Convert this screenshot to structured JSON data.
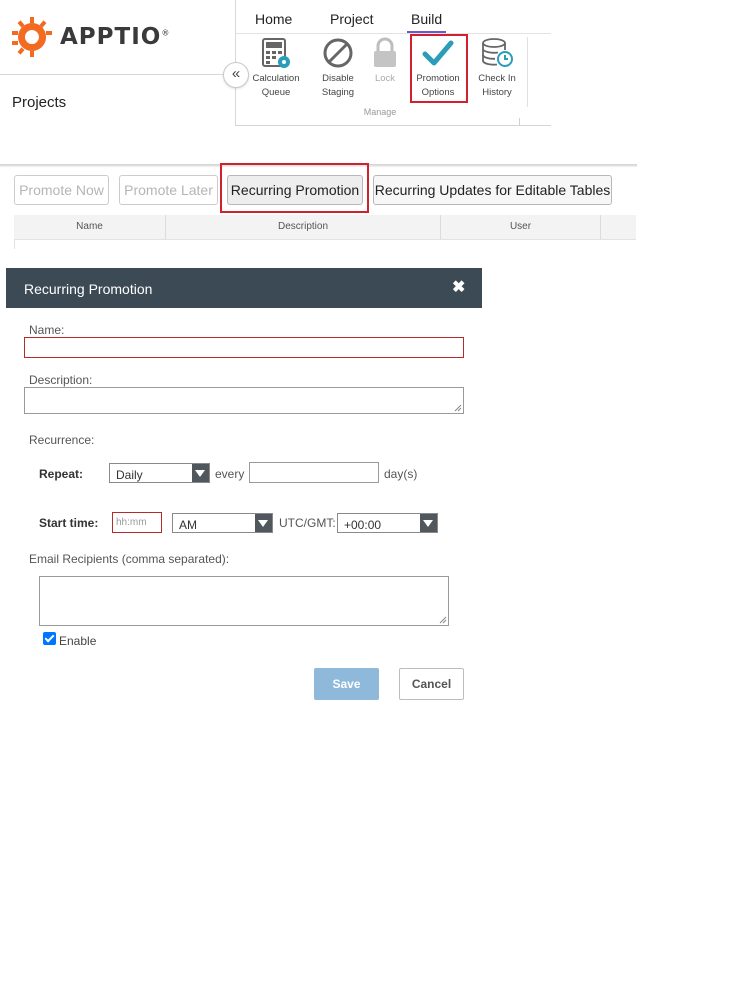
{
  "app": {
    "logo_text": "APPTIO",
    "logo_mark": "®"
  },
  "sidebar": {
    "title": "Projects"
  },
  "tabs": [
    {
      "label": "Home"
    },
    {
      "label": "Project"
    },
    {
      "label": "Build",
      "active": true
    }
  ],
  "ribbon": {
    "group_label": "Manage",
    "buttons": [
      {
        "label1": "Calculation",
        "label2": "Queue",
        "icon": "calculator-icon"
      },
      {
        "label1": "Disable",
        "label2": "Staging",
        "icon": "prohibit-icon"
      },
      {
        "label1": "Lock",
        "label2": "",
        "icon": "lock-icon",
        "disabled": true
      },
      {
        "label1": "Promotion",
        "label2": "Options",
        "icon": "checkmark-icon"
      },
      {
        "label1": "Check In",
        "label2": "History",
        "icon": "database-history-icon"
      }
    ]
  },
  "toolbar": {
    "promote_now": "Promote Now",
    "promote_later": "Promote Later",
    "recurring_promotion": "Recurring Promotion",
    "recurring_updates": "Recurring Updates for Editable Tables"
  },
  "grid": {
    "columns": [
      "Name",
      "Description",
      "User"
    ]
  },
  "dialog": {
    "title": "Recurring Promotion",
    "close_glyph": "✖",
    "name_label": "Name:",
    "name_value": "",
    "description_label": "Description:",
    "description_value": "",
    "recurrence_label": "Recurrence:",
    "repeat_label": "Repeat:",
    "repeat_value": "Daily",
    "every_label": "every",
    "every_value": "",
    "days_label": "day(s)",
    "start_time_label": "Start time:",
    "time_placeholder": "hh:mm",
    "ampm_value": "AM",
    "utc_label": "UTC/GMT:",
    "tz_value": "+00:00",
    "email_label": "Email Recipients (comma separated):",
    "email_value": "",
    "enable_label": "Enable",
    "enable_checked": true,
    "save_label": "Save",
    "cancel_label": "Cancel"
  },
  "colors": {
    "brand_orange": "#f26b21",
    "highlight_red": "#d2202e",
    "dialog_header": "#3b4a55",
    "save_button": "#8fb9db",
    "checkmark_teal": "#2a9db8",
    "tab_underline": "#6a5acd"
  }
}
